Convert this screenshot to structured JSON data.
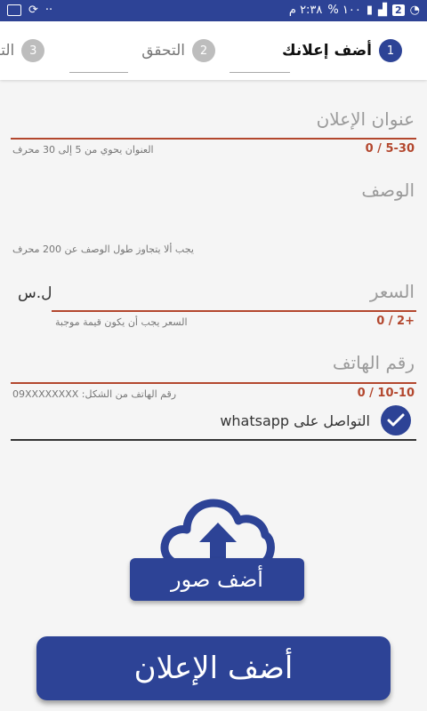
{
  "statusbar": {
    "time": "٢:٣٨ م",
    "battery": "١٠٠ %",
    "notification_badge": "2",
    "dots": "··"
  },
  "stepper": {
    "steps": [
      {
        "number": "1",
        "label": "أضف إعلانك"
      },
      {
        "number": "2",
        "label": "التحقق"
      },
      {
        "number": "3",
        "label": "التأك"
      }
    ]
  },
  "form": {
    "title_field": {
      "label": "عنوان الإعلان",
      "hint": "العنوان يحوي من 5 إلى 30 محرف",
      "counter": "0 / 5-30"
    },
    "description_field": {
      "label": "الوصف",
      "hint": "يجب ألا يتجاوز طول الوصف عن 200 محرف"
    },
    "price_field": {
      "label": "السعر",
      "currency": "ل.س",
      "hint": "السعر يجب أن يكون قيمة موجبة",
      "counter": "0 / 2+"
    },
    "phone_field": {
      "label": "رقم الهاتف",
      "hint": "رقم الهاتف من الشكل: 09XXXXXXXX",
      "counter": "0 / 10-10"
    },
    "whatsapp": {
      "label": "التواصل على whatsapp",
      "checked": true
    }
  },
  "buttons": {
    "add_photos": "أضف صور",
    "submit": "أضف الإعلان"
  },
  "colors": {
    "primary": "#2d4396",
    "accent_red": "#b3472e"
  }
}
